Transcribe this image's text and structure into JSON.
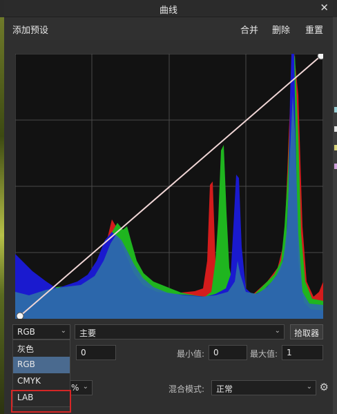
{
  "dialog": {
    "title": "曲线",
    "close": "✕"
  },
  "toolbar": {
    "add_preset": "添加预设",
    "merge": "合并",
    "delete": "删除",
    "reset": "重置"
  },
  "controls": {
    "channel_value": "RGB",
    "layer_value": "主要",
    "picker_label": "拾取器",
    "left_value": "0",
    "min_label": "最小值:",
    "min_value": "0",
    "max_label": "最大值:",
    "max_value": "1",
    "opacity_suffix": "%",
    "blend_label": "混合模式:",
    "blend_value": "正常"
  },
  "channel_menu": {
    "items": [
      "灰色",
      "RGB",
      "CMYK",
      "LAB"
    ],
    "selected": "RGB",
    "highlighted": "LAB"
  },
  "colors": {
    "graph_bg": "#121212",
    "grid": "#4a4a4a",
    "red": "#d41c1c",
    "green": "#1fb51f",
    "blue": "#1a1acf",
    "composite": "#2e6ea8",
    "curve": "#f0d6d6",
    "highlight_box": "#d62626"
  },
  "icons": {
    "close": "close-icon",
    "chevron": "chevron-down-icon",
    "settings": "gear-icon"
  }
}
